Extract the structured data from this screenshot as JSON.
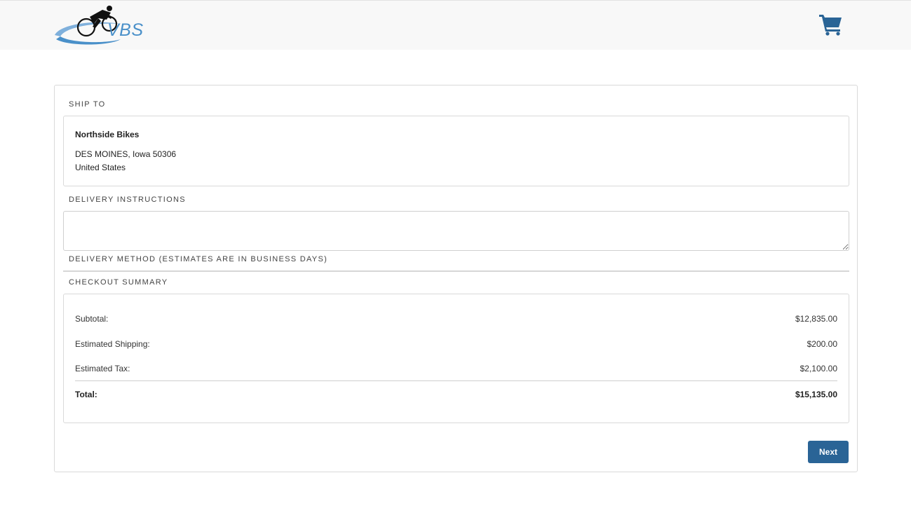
{
  "header": {
    "logo_text": "VBS",
    "cart_icon": "shopping-cart-icon",
    "brand_color": "#4a90c9",
    "cart_color": "#2a6496"
  },
  "ship_to": {
    "label": "SHIP TO",
    "name": "Northside Bikes",
    "city_line": "DES MOINES, Iowa 50306",
    "country": "United States"
  },
  "delivery_instructions": {
    "label": "DELIVERY INSTRUCTIONS",
    "value": ""
  },
  "delivery_method": {
    "label": "DELIVERY METHOD (ESTIMATES ARE IN BUSINESS DAYS)"
  },
  "checkout_summary": {
    "label": "CHECKOUT SUMMARY",
    "subtotal_label": "Subtotal:",
    "subtotal_value": "$12,835.00",
    "shipping_label": "Estimated Shipping:",
    "shipping_value": "$200.00",
    "tax_label": "Estimated Tax:",
    "tax_value": "$2,100.00",
    "total_label": "Total:",
    "total_value": "$15,135.00"
  },
  "actions": {
    "next_label": "Next",
    "button_color": "#2a6496"
  }
}
